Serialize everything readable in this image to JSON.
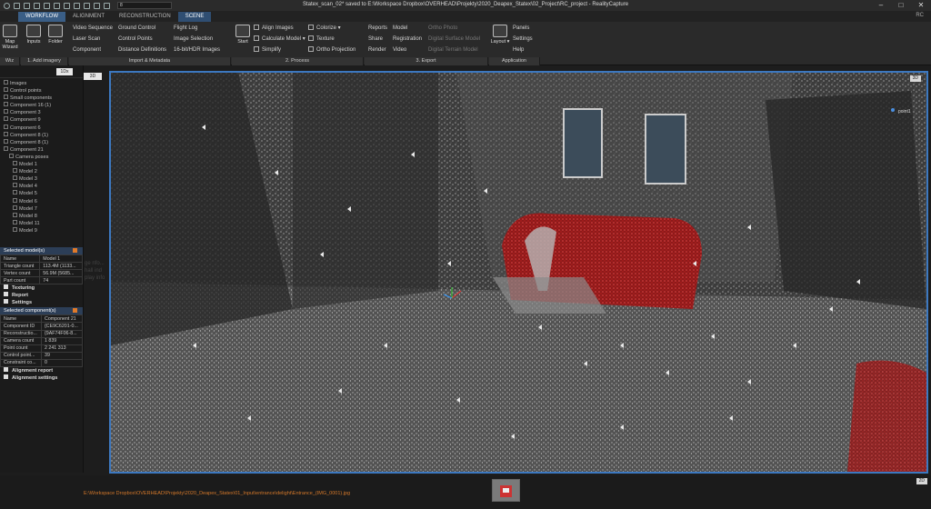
{
  "window": {
    "title": "Statex_scan_02* saved to E:\\Workspace Dropbox\\OVERHEAD\\Projekty\\2020_Deapex_Statex\\02_Project\\RC_project - RealityCapture",
    "combo_value": "8"
  },
  "tabs": [
    {
      "label": "WORKFLOW"
    },
    {
      "label": "ALIGNMENT"
    },
    {
      "label": "RECONSTRUCTION"
    },
    {
      "label": "SCENE"
    }
  ],
  "user_badge": "RC",
  "ribbon": {
    "wiz": {
      "label": "Wiz",
      "button": "Map Wizard"
    },
    "add_imagery": {
      "label": "1. Add imagery",
      "inputs": "Inputs",
      "folder": "Folder"
    },
    "import": {
      "label": "Import & Metadata",
      "col1": [
        "Video Sequence",
        "Laser Scan",
        "Component"
      ],
      "col2": [
        "Ground Control",
        "Control Points",
        "Distance Definitions"
      ],
      "col3": [
        "Flight Log",
        "Image Selection",
        "16-bit/HDR Images"
      ]
    },
    "process": {
      "label": "2. Process",
      "start": "Start",
      "col1": [
        "Align Images",
        "Calculate Model",
        "Simplify"
      ],
      "col2": [
        "Colorize",
        "Texture",
        "Ortho Projection"
      ]
    },
    "export": {
      "label": "3. Export",
      "col1": [
        "Reports",
        "Share",
        "Render"
      ],
      "col2": [
        "Model",
        "Registration",
        "Video"
      ],
      "col3": [
        "Ortho Photo",
        "Digital Surface Model",
        "Digital Terrain Model"
      ]
    },
    "application": {
      "label": "Application",
      "layout": "Layout",
      "col1": [
        "Panels",
        "Settings",
        "Help"
      ]
    }
  },
  "left_panel": {
    "top_buttons": [
      "1Dx",
      "3D"
    ],
    "tree": [
      "Images",
      "Control points",
      "Small components",
      "Component 16 (1)",
      "Component 3",
      "Component 9",
      "Component 6",
      "Component 8 (1)",
      "Component 8 (1)",
      "Component 21",
      "Camera poses",
      "Model 1",
      "Model 2",
      "Model 3",
      "Model 4",
      "Model 5",
      "Model 6",
      "Model 7",
      "Model 8",
      "Model 11",
      "Model 9"
    ],
    "selected_models": {
      "title": "Selected model(s)",
      "rows": [
        [
          "Name",
          "Model 1"
        ],
        [
          "Triangle count",
          "113.4M (1133..."
        ],
        [
          "Vertex count",
          "56.9M (5685..."
        ],
        [
          "Part count",
          "74"
        ]
      ],
      "sections": [
        "Texturing",
        "Report",
        "Settings"
      ]
    },
    "selected_components": {
      "title": "Selected component(s)",
      "rows": [
        [
          "Name",
          "Component 21"
        ],
        [
          "Component ID",
          "{CE9C6201-0..."
        ],
        [
          "Reconstructio...",
          "{9AF74F06-8..."
        ],
        [
          "Camera count",
          "1 839"
        ],
        [
          "Point count",
          "2 241 313"
        ],
        [
          "Control point...",
          "39"
        ],
        [
          "Constraint co...",
          "0"
        ]
      ],
      "sections": [
        "Alignment report",
        "Alignment settings"
      ]
    },
    "ghost_text": [
      "ge nfo...",
      "hall ind",
      "play info"
    ]
  },
  "viewport": {
    "mode_label": "3D",
    "point_label": "point1"
  },
  "bottom": {
    "path": "E:\\Workspace Dropbox\\OVERHEAD\\Projekty\\2020_Deapex_Statex\\01_Input\\entrance\\delight\\Entrance_(IMG_0001).jpg",
    "mode_label": "2D"
  }
}
